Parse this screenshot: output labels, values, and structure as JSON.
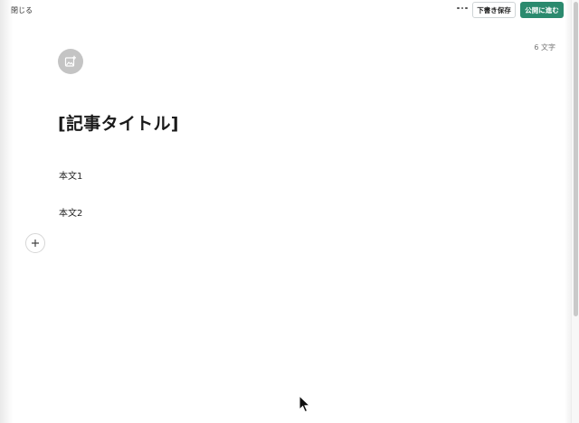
{
  "header": {
    "close_label": "閉じる",
    "more_icon": "more-horizontal-icon",
    "draft_label": "下書き保存",
    "publish_label": "公開に進む"
  },
  "editor": {
    "char_count": "6 文字",
    "image_icon": "add-image-icon",
    "title": "[記事タイトル]",
    "paragraphs": [
      "本文1",
      "本文2"
    ],
    "add_icon": "plus-icon"
  },
  "colors": {
    "accent": "#2b8a6e",
    "icon_bg": "#c4c4c4"
  }
}
